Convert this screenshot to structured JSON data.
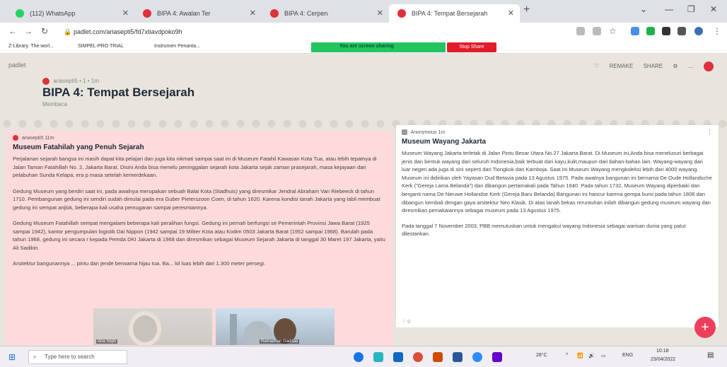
{
  "browser": {
    "tabs": [
      {
        "label": "(112) WhatsApp",
        "color": "#25d366"
      },
      {
        "label": "BIPA 4: Awalan Ter",
        "color": "#e0303a"
      },
      {
        "label": "BIPA 4: Cerpen",
        "color": "#e0303a"
      },
      {
        "label": "BIPA 4: Tempat Bersejarah",
        "color": "#e0303a"
      }
    ],
    "url": "padlet.com/ariasepti5/fd7xtiavdpoko9h",
    "bookmarks": [
      "Z-Library. The worl...",
      "SIMPEL-PRO TRIAL",
      "Instrumen Penanta..."
    ],
    "share_text": "You are screen sharing",
    "stop_label": "Stop Share"
  },
  "padlet": {
    "brand": "padlet",
    "toolbar": [
      "REMAKE",
      "SHARE"
    ],
    "author_line": "ariasepti5 • 1 • 1m",
    "title": "BIPA 4: Tempat Bersejarah",
    "subtitle": "Membaca",
    "post1": {
      "author": "ariasepti5 11m",
      "title": "Museum Fatahilah yang Penuh Sejarah",
      "paragraphs": [
        "Perjalanan sejarah bangsa ini masih dapat kita pelajari dan juga kita nikmati sampai saat ini di Museum Fatahil Kawasan Kota Tua, atau lebih tepatnya di Jalan Taman Fatahillah No. 2, Jakarta Barat. Disini Anda bisa menelu peninggalan sejarah kota Jakarta sejak zaman prasejarah, masa kejayaan dari pelabuhan Sunda Kelapa, era p masa setelah kemerdekaan.",
        "Gedung Museum yang berdiri saat ini, pada awalnya merupakan sebuah Balai Kota (Stadhuis) yang diresmikar Jendral Abraham Van Riebeeck di tahun 1710. Pembangunan gedung ini sendiri sudah dimulai pada era Guber Pieterszoon Coen, di tahun 1620. Karena kondisi tanah Jakarta yang labil membuat gedung ini sempat anjlok, beberapa kali usaha pemugaran sampai peresmiannya.",
        "Gedung Museum Fatahillah sempat mengalami beberapa kali peralihan fungsi. Gedung ini pernah berfungsi se Pemerintah Provinsi Jawa Barat (1925 sampai 1942), kantor pengumpulan logistik Dai Nippon (1942 sampai 19 Militer Kota atau Kodim 0503 Jakarta Barat (1952 sampai 1968). Barulah pada tahun 1968, gedung ini secara r kepada Pemda DKI Jakarta di 1968 dan diresmikan sebagai Museum Sejarah Jakarta di tanggal 30 Maret 197 Jakarta, yaitu Ali Sadikin.",
        "Arsitektur bangunannya ... pintu dan jende berwarna hijau tua. Ba... kil luas lebih dari 1.300 meter persegi."
      ]
    },
    "post2": {
      "author": "Anonymous 1m",
      "title": "Museum Wayang Jakarta",
      "paragraphs": [
        "Museum Wayang Jakarta terletak di Jalan Pintu Besar Utara No.27 Jakarta Barat. Di Museum ini,Anda bisa menelusuri berbagai jenis dan bentuk wayang dari seluruh Indonesia,baik terbuat dari kayu,kulit,maupun dari bahan-bahan lain. Wayang-wayang dari luar negeri ada juga di sini seperti dari Tiongkok dan Kamboja. Saat ini Museum Wayang mengkoleksi lebih dari 4000 wayang. Museum ini didirikan oleh Yayasan Oud Betavia pada 13 Agustus 1975. Pada awalnya bangunan ini bernama De Oude Hollandsche Kerk (\"Gereja Lama Belanda\") dan dibangun pertamakali pada Tahun 1640. Pada tahun 1732, Museum Wayang diperbaiki dan berganti nama De Nieuwe Hollandse Kerk (Gereja Baru Belanda) Bangunan ini hancur karena gempa bumi pada tahun 1808 dan dibangun kembali dengan gaya arsitektur Neo Klasik. Di atas tanah bekas reruntuhan inilah dibangun gedung museum wayang dan diresmikan pemakaiannya sebagai museum pada 13 Agustus 1975.",
        "Pada tanggal 7 November 2003, PBB memutuskan untuk mengakui wayang Indonesia sebagai warisan dunia yang patut dilestarikan."
      ],
      "likes": "0"
    }
  },
  "video": {
    "person1": "Aria Septi",
    "person2": "Ramadhan Gaddaa"
  },
  "taskbar": {
    "search_placeholder": "Type here to search",
    "weather": "28°C",
    "lang": "ENG",
    "time": "10:18",
    "date": "23/04/2022"
  }
}
